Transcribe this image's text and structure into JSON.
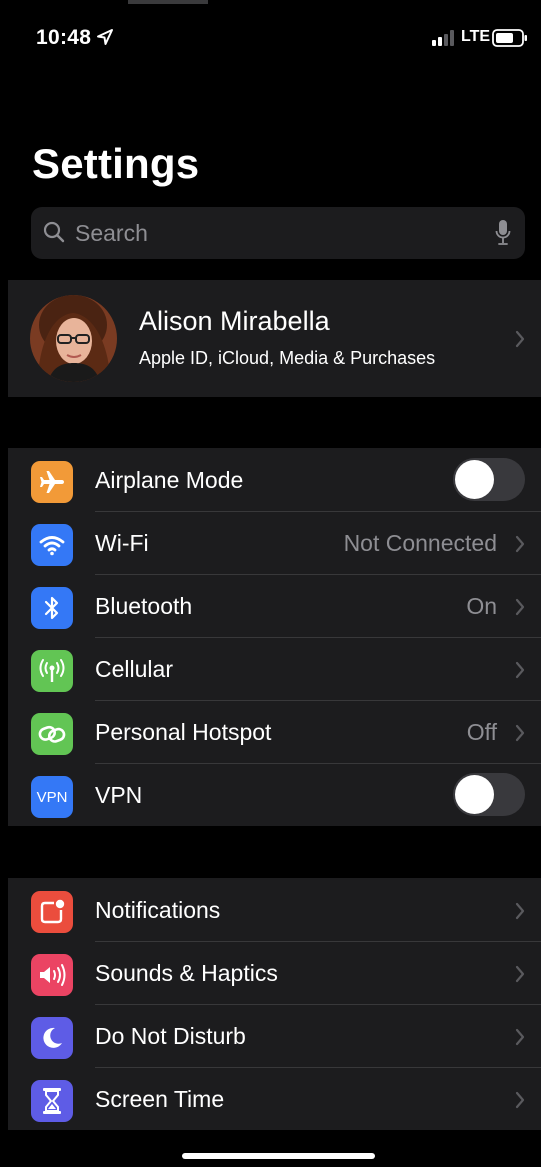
{
  "status": {
    "time": "10:48",
    "network": "LTE",
    "signal_bars_active": 2,
    "signal_bars_total": 4
  },
  "page_title": "Settings",
  "search": {
    "placeholder": "Search"
  },
  "profile": {
    "name": "Alison Mirabella",
    "subtitle": "Apple ID, iCloud, Media & Purchases"
  },
  "connectivity": [
    {
      "label": "Airplane Mode",
      "icon": "airplane-icon",
      "color": "#f29a38",
      "control": "toggle",
      "on": false
    },
    {
      "label": "Wi-Fi",
      "icon": "wifi-icon",
      "color": "#3478f6",
      "value": "Not Connected"
    },
    {
      "label": "Bluetooth",
      "icon": "bluetooth-icon",
      "color": "#3478f6",
      "value": "On"
    },
    {
      "label": "Cellular",
      "icon": "cellular-antenna-icon",
      "color": "#62c554"
    },
    {
      "label": "Personal Hotspot",
      "icon": "hotspot-icon",
      "color": "#62c554",
      "value": "Off"
    },
    {
      "label": "VPN",
      "icon": "vpn-icon",
      "icon_text": "VPN",
      "color": "#3478f6",
      "control": "toggle",
      "on": false
    }
  ],
  "general": [
    {
      "label": "Notifications",
      "icon": "notifications-icon",
      "color": "#eb4d3d"
    },
    {
      "label": "Sounds & Haptics",
      "icon": "speaker-icon",
      "color": "#eb4463"
    },
    {
      "label": "Do Not Disturb",
      "icon": "moon-icon",
      "color": "#5e5ce6"
    },
    {
      "label": "Screen Time",
      "icon": "hourglass-icon",
      "color": "#5e5ce6"
    }
  ],
  "colors": {
    "background": "#000000",
    "cell": "#1c1c1e",
    "secondary_text": "#8e8e93",
    "toggle_off": "#39393d"
  }
}
